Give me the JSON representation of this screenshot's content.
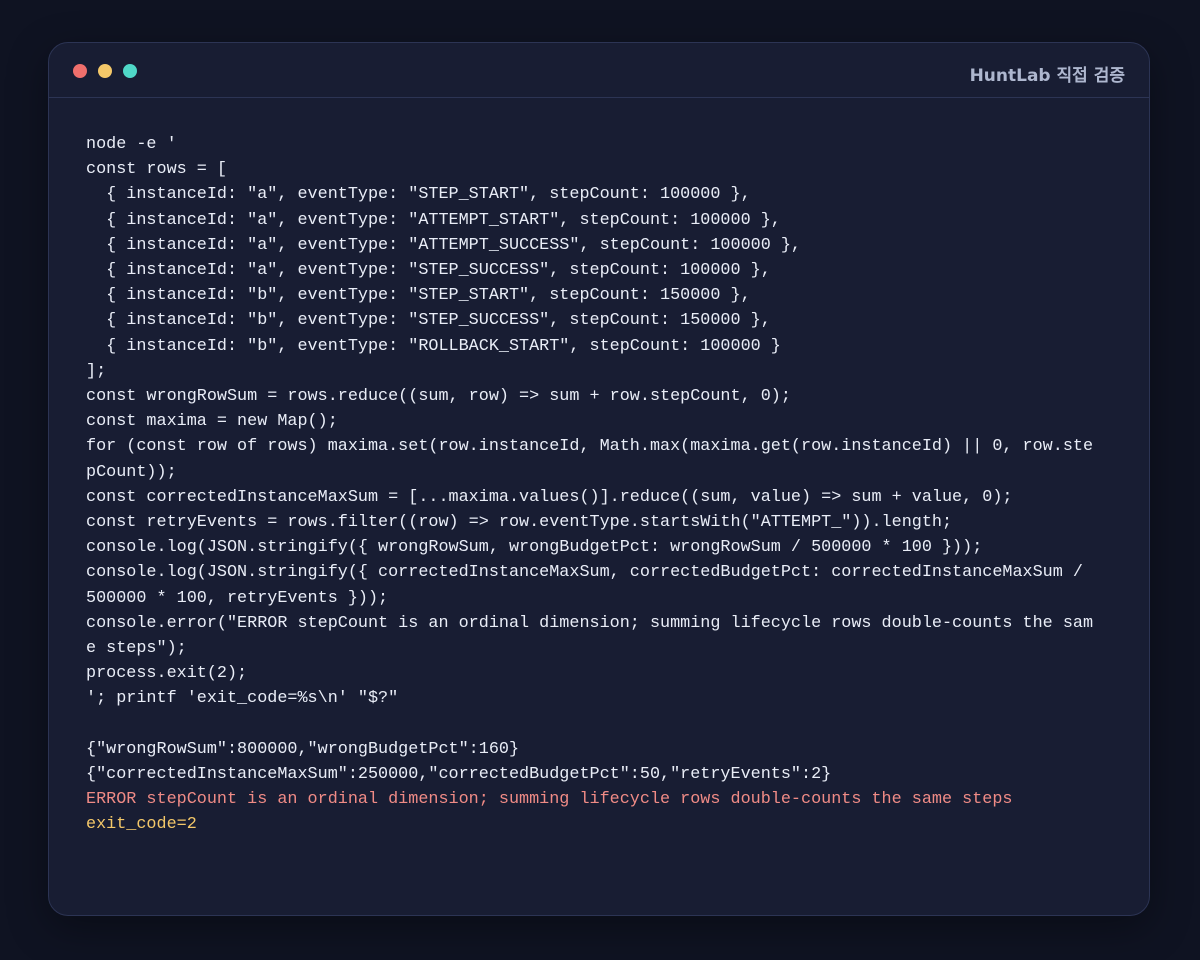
{
  "window": {
    "title": "HuntLab 직접 검증",
    "controls": {
      "close_color": "#ef6f6c",
      "minimize_color": "#f4c869",
      "maximize_color": "#4fd8c8"
    }
  },
  "terminal": {
    "command_lines": [
      "node -e '",
      "const rows = [",
      "  { instanceId: \"a\", eventType: \"STEP_START\", stepCount: 100000 },",
      "  { instanceId: \"a\", eventType: \"ATTEMPT_START\", stepCount: 100000 },",
      "  { instanceId: \"a\", eventType: \"ATTEMPT_SUCCESS\", stepCount: 100000 },",
      "  { instanceId: \"a\", eventType: \"STEP_SUCCESS\", stepCount: 100000 },",
      "  { instanceId: \"b\", eventType: \"STEP_START\", stepCount: 150000 },",
      "  { instanceId: \"b\", eventType: \"STEP_SUCCESS\", stepCount: 150000 },",
      "  { instanceId: \"b\", eventType: \"ROLLBACK_START\", stepCount: 100000 }",
      "];",
      "const wrongRowSum = rows.reduce((sum, row) => sum + row.stepCount, 0);",
      "const maxima = new Map();",
      "for (const row of rows) maxima.set(row.instanceId, Math.max(maxima.get(row.instanceId) || 0, row.ste",
      "pCount));",
      "const correctedInstanceMaxSum = [...maxima.values()].reduce((sum, value) => sum + value, 0);",
      "const retryEvents = rows.filter((row) => row.eventType.startsWith(\"ATTEMPT_\")).length;",
      "console.log(JSON.stringify({ wrongRowSum, wrongBudgetPct: wrongRowSum / 500000 * 100 }));",
      "console.log(JSON.stringify({ correctedInstanceMaxSum, correctedBudgetPct: correctedInstanceMaxSum /",
      "500000 * 100, retryEvents }));",
      "console.error(\"ERROR stepCount is an ordinal dimension; summing lifecycle rows double-counts the sam",
      "e steps\");",
      "process.exit(2);",
      "'; printf 'exit_code=%s\\n' \"$?\""
    ],
    "stdout_lines": [
      "{\"wrongRowSum\":800000,\"wrongBudgetPct\":160}",
      "{\"correctedInstanceMaxSum\":250000,\"correctedBudgetPct\":50,\"retryEvents\":2}"
    ],
    "stderr_line": "ERROR stepCount is an ordinal dimension; summing lifecycle rows double-counts the same steps",
    "exit_line": "exit_code=2",
    "colors": {
      "text": "#e9edf7",
      "error": "#f08b86",
      "exit": "#f4c869"
    }
  }
}
